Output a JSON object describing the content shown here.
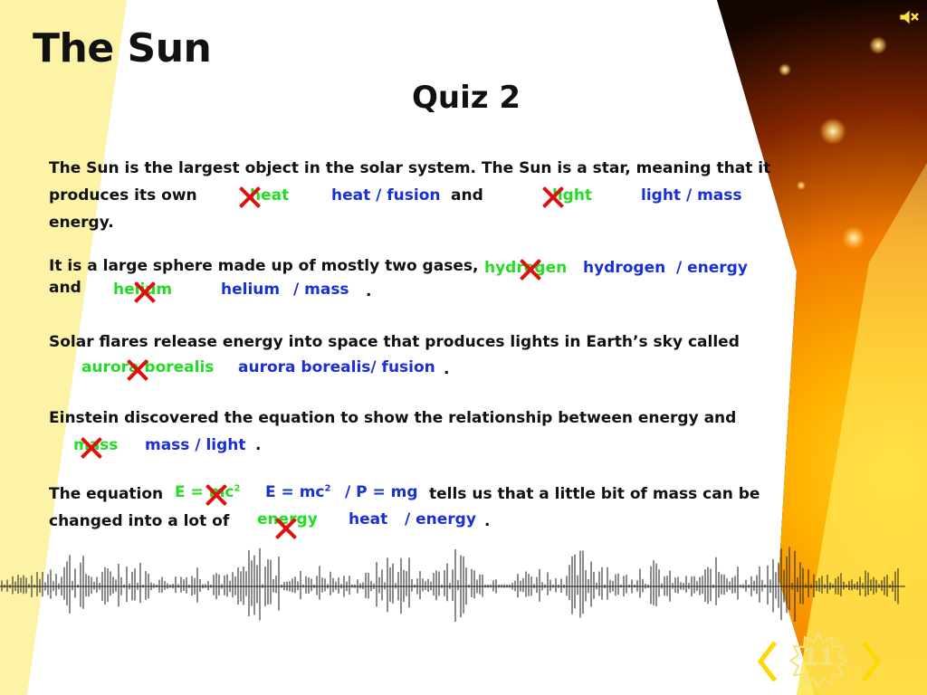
{
  "title": "The Sun",
  "subtitle": "Quiz 2",
  "q1": {
    "line1": "The Sun is the largest object in the solar system. The Sun is a star, meaning that it",
    "pre": "produces its own",
    "answer1": "heat",
    "options1": "heat / fusion",
    "mid": "and",
    "answer2": "light",
    "options2": "light / mass",
    "line3": "energy."
  },
  "q2": {
    "line1": "It is a large sphere made up of mostly two gases,",
    "answer1": "hydrogen",
    "options1a": "hydrogen",
    "options1b": "/ energy",
    "pre2": "and",
    "answer2": "helium",
    "options2a": "helium",
    "options2b": "/ mass",
    "end": "."
  },
  "q3": {
    "line1": "Solar flares release energy into space that produces lights in Earth’s sky called",
    "answer": "aurora borealis",
    "options": "aurora borealis/ fusion",
    "end": "."
  },
  "q4": {
    "line1": "Einstein discovered the equation to show the relationship between energy and",
    "answer": "mass",
    "options": "mass / light",
    "end": "."
  },
  "q5": {
    "pre": "The equation",
    "answer1": "E = mc",
    "options1a": "E = mc",
    "options1b": "/ P = mg",
    "post": "tells us that a little bit of mass can be",
    "line2": "changed into a lot of",
    "answer2": "energy",
    "options2a": "heat",
    "options2b": "/ energy",
    "end": "."
  },
  "superscript": "2",
  "page_number": "11",
  "colors": {
    "answer_green": "#22dd22",
    "option_blue": "#1a2fd6",
    "wrong_mark_red": "#e01010",
    "left_band_yellow": "#fcf3a6"
  },
  "icons": {
    "audio": "speaker-muted-icon",
    "prev": "chevron-left-icon",
    "next": "chevron-right-icon"
  }
}
